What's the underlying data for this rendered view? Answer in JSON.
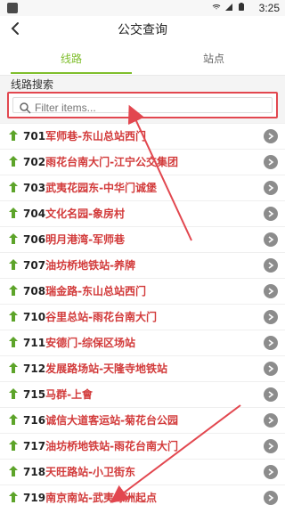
{
  "status": {
    "time": "3:25",
    "icons": [
      "wifi-icon",
      "signal-icon",
      "battery-icon"
    ]
  },
  "header": {
    "title": "公交查询",
    "back_icon": "back-arrow-icon"
  },
  "tabs": [
    {
      "label": "线路"
    },
    {
      "label": "站点"
    }
  ],
  "search": {
    "label": "线路搜索",
    "placeholder": "Filter items..."
  },
  "routes": [
    {
      "num": "701",
      "text": "军师巷-东山总站西门"
    },
    {
      "num": "702",
      "text": "雨花台南大门-江宁公交集团"
    },
    {
      "num": "703",
      "text": "武夷花园东-中华门诚堡"
    },
    {
      "num": "704",
      "text": "文化名园-象房村"
    },
    {
      "num": "706",
      "text": "明月港湾-军师巷"
    },
    {
      "num": "707",
      "text": "油坊桥地铁站-养牌"
    },
    {
      "num": "708",
      "text": "瑞金路-东山总站西门"
    },
    {
      "num": "710",
      "text": "谷里总站-雨花台南大门"
    },
    {
      "num": "711",
      "text": "安德门-综保区场站"
    },
    {
      "num": "712",
      "text": "发展路场站-天隆寺地铁站"
    },
    {
      "num": "715",
      "text": "马群-上會"
    },
    {
      "num": "716",
      "text": "诚信大道客运站-菊花台公园"
    },
    {
      "num": "717",
      "text": "油坊桥地铁站-雨花台南大门"
    },
    {
      "num": "718",
      "text": "天旺路站-小卫街东"
    },
    {
      "num": "719",
      "text": "南京南站-武夷绿洲起点"
    }
  ],
  "colors": {
    "accent_green": "#7fbe2c",
    "red_highlight": "#e2474f",
    "stops_red": "#d23a3a"
  }
}
